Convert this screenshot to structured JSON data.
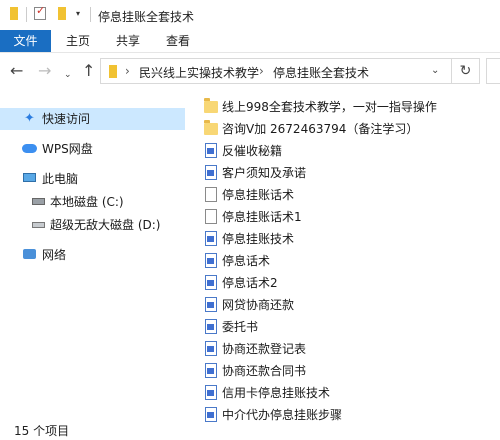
{
  "window": {
    "title": "停息挂账全套技术"
  },
  "ribbon": {
    "tabs": [
      "文件",
      "主页",
      "共享",
      "查看"
    ]
  },
  "address": {
    "crumbs": [
      "民兴线上实操技术教学",
      "停息挂账全套技术"
    ]
  },
  "nav": {
    "items": [
      {
        "label": "快速访问",
        "icon": "star-pin-icon",
        "selected": true
      },
      {
        "label": "WPS网盘",
        "icon": "cloud-icon"
      },
      {
        "label": "此电脑",
        "icon": "computer-icon"
      },
      {
        "label": "本地磁盘 (C:)",
        "icon": "drive-icon"
      },
      {
        "label": "超级无敌大磁盘 (D:)",
        "icon": "drive-icon"
      },
      {
        "label": "网络",
        "icon": "network-icon"
      }
    ]
  },
  "files": [
    {
      "name": "线上998全套技术教学，一对一指导操作",
      "type": "folder"
    },
    {
      "name": "咨询V加  2672463794（备注学习）",
      "type": "folder"
    },
    {
      "name": "反催收秘籍",
      "type": "wps"
    },
    {
      "name": "客户须知及承诺",
      "type": "wps"
    },
    {
      "name": "停息挂账话术",
      "type": "doc"
    },
    {
      "name": "停息挂账话术1",
      "type": "doc"
    },
    {
      "name": "停息挂账技术",
      "type": "wps"
    },
    {
      "name": "停息话术",
      "type": "wps"
    },
    {
      "name": "停息话术2",
      "type": "wps"
    },
    {
      "name": "网贷协商还款",
      "type": "wps"
    },
    {
      "name": "委托书",
      "type": "wps"
    },
    {
      "name": "协商还款登记表",
      "type": "wps"
    },
    {
      "name": "协商还款合同书",
      "type": "wps"
    },
    {
      "name": "信用卡停息挂账技术",
      "type": "wps"
    },
    {
      "name": "中介代办停息挂账步骤",
      "type": "wps"
    }
  ],
  "status": {
    "count": "15 个项目"
  },
  "colors": {
    "accent": "#1a6ec2",
    "selection": "#cce8ff",
    "folder": "#f8d775"
  }
}
